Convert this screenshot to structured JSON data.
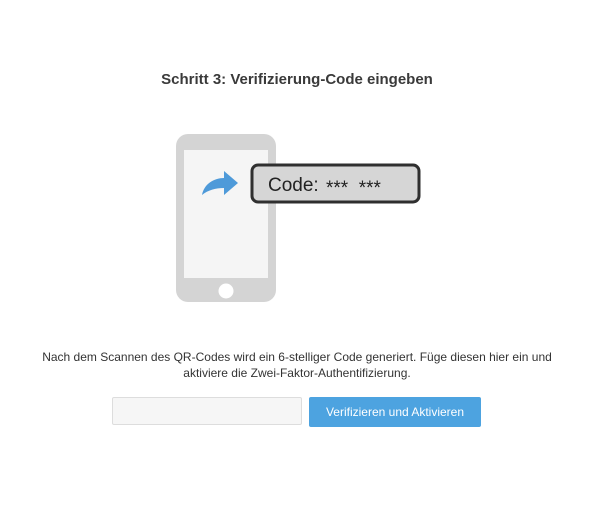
{
  "step": {
    "title": "Schritt 3: Verifizierung-Code eingeben"
  },
  "illustration": {
    "code_label": "Code:",
    "code_mask": "***  ***"
  },
  "instructions": {
    "text": "Nach dem Scannen des QR-Codes wird ein 6-stelliger Code generiert. Füge diesen hier ein und aktiviere die Zwei-Faktor-Authentifizierung."
  },
  "form": {
    "code_value": "",
    "code_placeholder": "",
    "submit_label": "Verifizieren und Aktivieren"
  },
  "colors": {
    "accent": "#4da3e0",
    "phone_frame": "#d4d4d4",
    "phone_screen": "#f5f5f5",
    "arrow": "#4e9ad9"
  },
  "icons": {
    "phone": "smartphone-icon",
    "arrow": "curved-arrow-icon"
  }
}
